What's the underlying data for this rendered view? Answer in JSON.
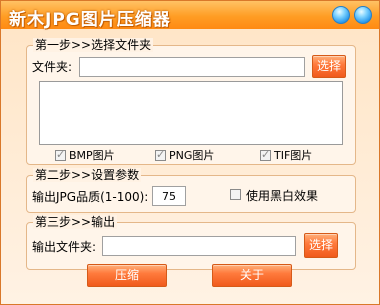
{
  "window": {
    "title": "新木JPG图片压缩器"
  },
  "step1": {
    "legend": "第一步>>选择文件夹",
    "folder_label": "文件夹:",
    "folder_value": "",
    "browse_label": "选择",
    "file_types": [
      {
        "label": "BMP图片",
        "checked": true
      },
      {
        "label": "PNG图片",
        "checked": true
      },
      {
        "label": "TIF图片",
        "checked": true
      }
    ]
  },
  "step2": {
    "legend": "第二步>>设置参数",
    "quality_label": "输出JPG品质(1-100):",
    "quality_value": "75",
    "bw_label": "使用黑白效果",
    "bw_checked": false
  },
  "step3": {
    "legend": "第三步>>输出",
    "output_label": "输出文件夹:",
    "output_value": "",
    "browse_label": "选择"
  },
  "actions": {
    "compress_label": "压缩",
    "about_label": "关于"
  }
}
